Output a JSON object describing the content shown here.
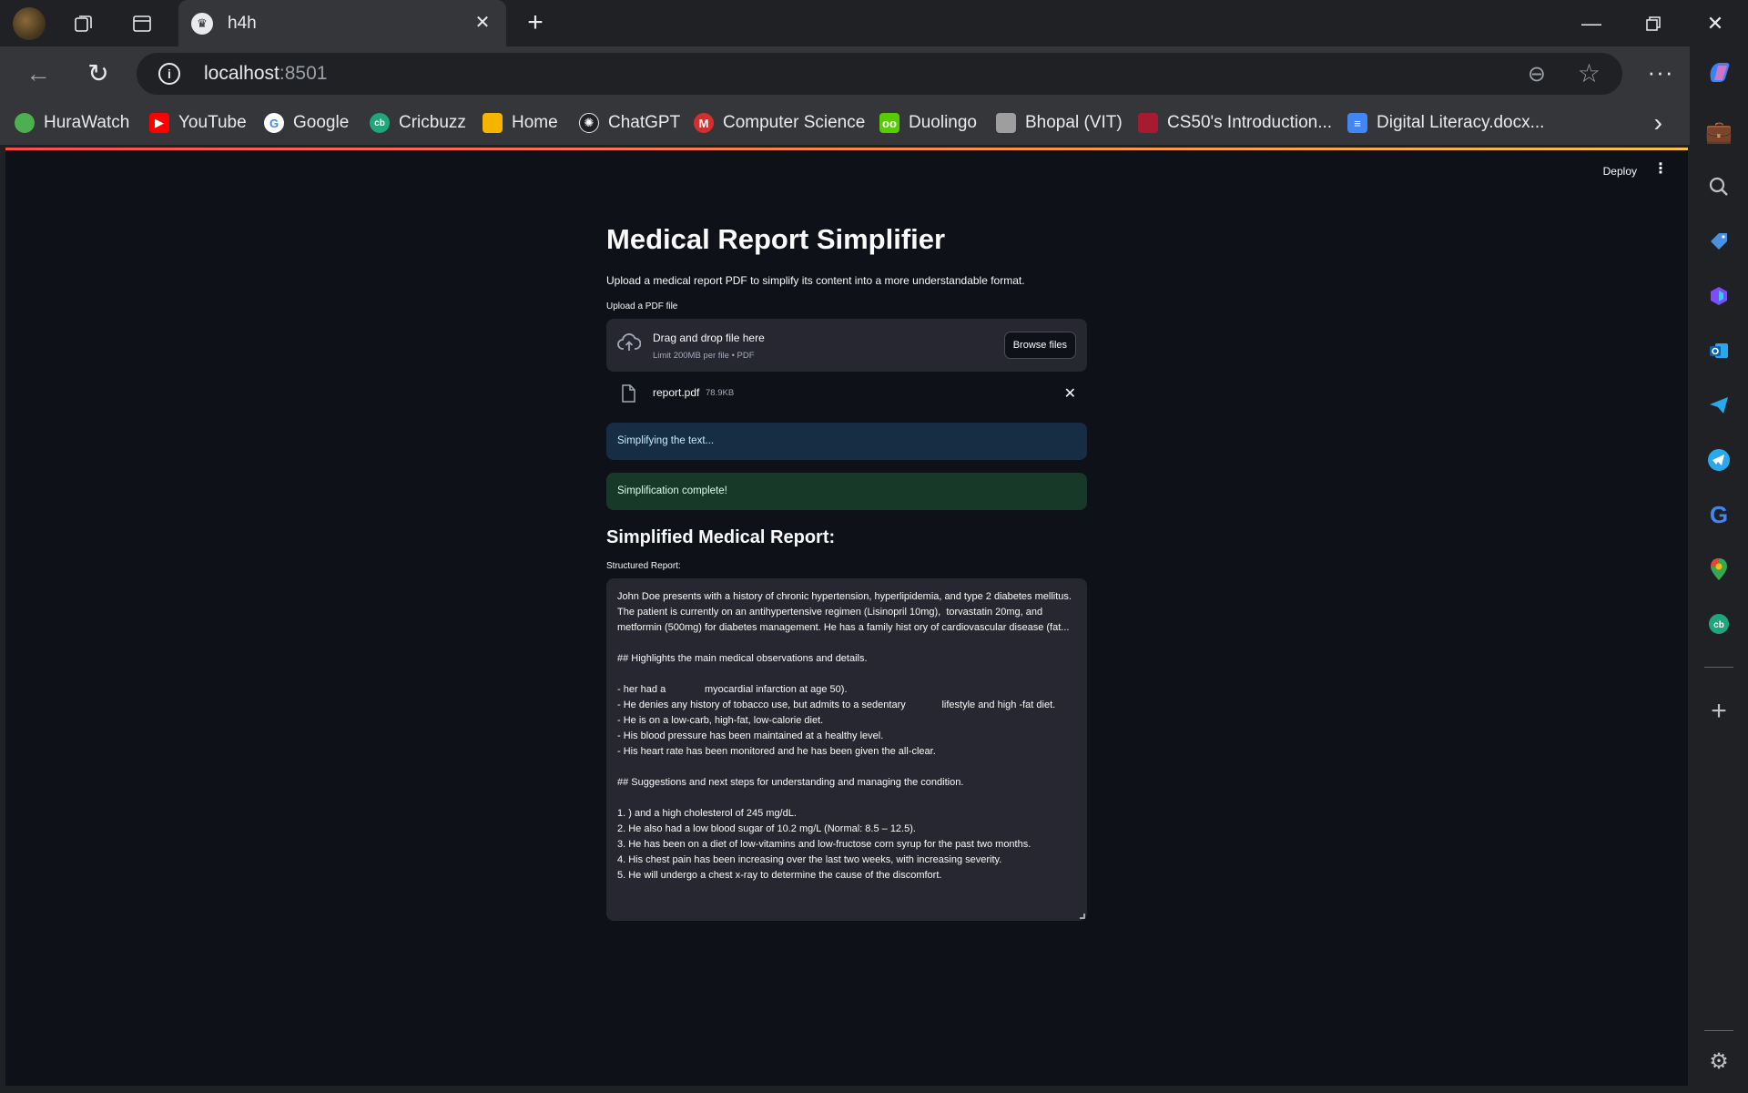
{
  "browser": {
    "tab_title": "h4h",
    "url_host": "localhost",
    "url_port": ":8501"
  },
  "bookmarks": [
    {
      "label": "HuraWatch",
      "icon": "hurawatch-icon",
      "color": "#4caf50"
    },
    {
      "label": "YouTube",
      "icon": "youtube-icon",
      "color": "#ff0000"
    },
    {
      "label": "Google",
      "icon": "google-icon",
      "color": "#4285f4"
    },
    {
      "label": "Cricbuzz",
      "icon": "cricbuzz-icon",
      "color": "#1fa67a"
    },
    {
      "label": "Home",
      "icon": "classroom-icon",
      "color": "#f4b400"
    },
    {
      "label": "ChatGPT",
      "icon": "chatgpt-icon",
      "color": "#10a37f"
    },
    {
      "label": "Computer Science",
      "icon": "mendeley-icon",
      "color": "#d32f2f"
    },
    {
      "label": "Duolingo",
      "icon": "duolingo-icon",
      "color": "#58cc02"
    },
    {
      "label": "Bhopal (VIT)",
      "icon": "vit-icon",
      "color": "#9e9e9e"
    },
    {
      "label": "CS50's Introduction...",
      "icon": "harvard-icon",
      "color": "#a51c30"
    },
    {
      "label": "Digital Literacy.docx...",
      "icon": "docs-icon",
      "color": "#4285f4"
    }
  ],
  "app": {
    "deploy_label": "Deploy",
    "title": "Medical Report Simplifier",
    "subtitle": "Upload a medical report PDF to simplify its content into a more understandable format.",
    "uploader_label": "Upload a PDF file",
    "dropzone_title": "Drag and drop file here",
    "dropzone_limit": "Limit 200MB per file • PDF",
    "browse_label": "Browse files",
    "file_name": "report.pdf",
    "file_size": "78.9KB",
    "info_message": "Simplifying the text...",
    "success_message": "Simplification complete!",
    "section_title": "Simplified Medical Report:",
    "textarea_label": "Structured Report:",
    "report_text": "John Doe presents with a history of chronic hypertension, hyperlipidemia, and type 2 diabetes mellitus. The patient is currently on an antihypertensive regimen (Lisinopril 10mg),  torvastatin 20mg, and metformin (500mg) for diabetes management. He has a family hist ory of cardiovascular disease (fat...\n\n## Highlights the main medical observations and details.\n\n- her had a              myocardial infarction at age 50).\n- He denies any history of tobacco use, but admits to a sedentary             lifestyle and high -fat diet.\n- He is on a low-carb, high-fat, low-calorie diet.\n- His blood pressure has been maintained at a healthy level.\n- His heart rate has been monitored and he has been given the all-clear.\n\n## Suggestions and next steps for understanding and managing the condition.\n\n1. ) and a high cholesterol of 245 mg/dL.\n2. He also had a low blood sugar of 10.2 mg/L (Normal: 8.5 – 12.5).\n3. He has been on a diet of low-vitamins and low-fructose corn syrup for the past two months.\n4. His chest pain has been increasing over the last two weeks, with increasing severity.\n5. He will undergo a chest x-ray to determine the cause of the discomfort."
  }
}
